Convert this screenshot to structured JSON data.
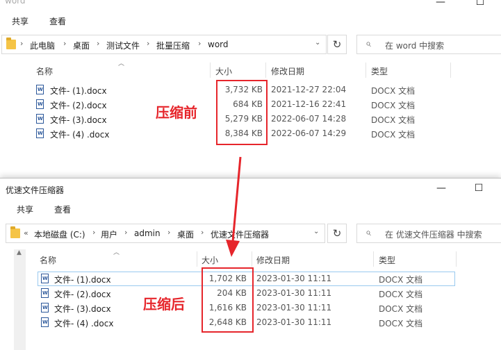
{
  "top_window": {
    "title": "word",
    "ribbon_tabs": [
      "共享",
      "查看"
    ],
    "breadcrumb": [
      "此电脑",
      "桌面",
      "测试文件",
      "批量压缩",
      "word"
    ],
    "search_placeholder": "在 word 中搜索",
    "columns": [
      "名称",
      "大小",
      "修改日期",
      "类型"
    ],
    "files": [
      {
        "name": "文件- (1).docx",
        "size": "3,732 KB",
        "date": "2021-12-27 22:04",
        "type": "DOCX 文档"
      },
      {
        "name": "文件- (2).docx",
        "size": "684 KB",
        "date": "2021-12-16 22:41",
        "type": "DOCX 文档"
      },
      {
        "name": "文件- (3).docx",
        "size": "5,279 KB",
        "date": "2022-06-07 14:28",
        "type": "DOCX 文档"
      },
      {
        "name": "文件- (4) .docx",
        "size": "8,384 KB",
        "date": "2022-06-07 14:29",
        "type": "DOCX 文档"
      }
    ],
    "annotation": "压缩前"
  },
  "bottom_window": {
    "title": "优速文件压缩器",
    "ribbon_tabs": [
      "共享",
      "查看"
    ],
    "breadcrumb_prefix": "«",
    "breadcrumb": [
      "本地磁盘 (C:)",
      "用户",
      "admin",
      "桌面",
      "优速文件压缩器"
    ],
    "search_placeholder": "在 优速文件压缩器 中搜索",
    "columns": [
      "名称",
      "大小",
      "修改日期",
      "类型"
    ],
    "files": [
      {
        "name": "文件- (1).docx",
        "size": "1,702 KB",
        "date": "2023-01-30 11:11",
        "type": "DOCX 文档"
      },
      {
        "name": "文件- (2).docx",
        "size": "204 KB",
        "date": "2023-01-30 11:11",
        "type": "DOCX 文档"
      },
      {
        "name": "文件- (3).docx",
        "size": "1,616 KB",
        "date": "2023-01-30 11:11",
        "type": "DOCX 文档"
      },
      {
        "name": "文件- (4) .docx",
        "size": "2,648 KB",
        "date": "2023-01-30 11:11",
        "type": "DOCX 文档"
      }
    ],
    "annotation": "压缩后"
  },
  "colors": {
    "annotation_red": "#e6252b",
    "selection_border": "#99c9ef",
    "folder_yellow": "#f5c446"
  },
  "icons": [
    "folder-icon",
    "chevron-right-icon",
    "chevron-down-icon",
    "refresh-icon",
    "search-icon",
    "word-doc-icon",
    "minimize-icon",
    "maximize-icon",
    "close-icon",
    "sort-up-icon"
  ]
}
